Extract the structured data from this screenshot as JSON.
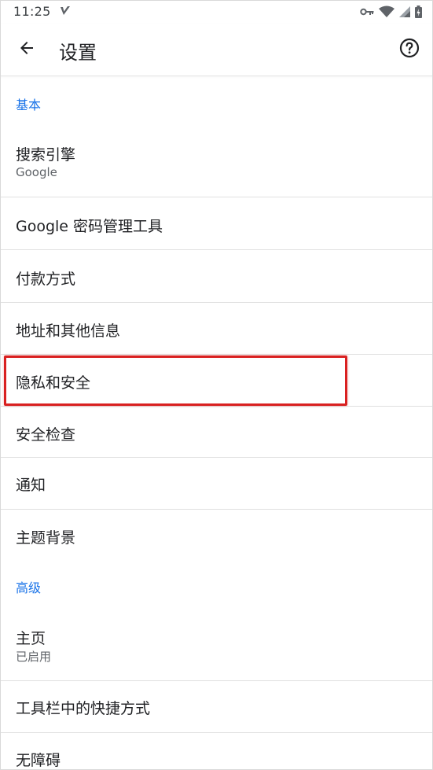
{
  "status_bar": {
    "time": "11:25",
    "icons": [
      "notification-check-icon",
      "vpn-key-icon",
      "wifi-icon",
      "cell-signal-icon",
      "battery-icon"
    ]
  },
  "app_bar": {
    "title": "设置",
    "back_icon": "arrow-back-icon",
    "help_icon": "help-circle-icon"
  },
  "sections": {
    "basic": {
      "header": "基本",
      "items": [
        {
          "label": "搜索引擎",
          "sublabel": "Google"
        },
        {
          "label": "Google 密码管理工具"
        },
        {
          "label": "付款方式"
        },
        {
          "label": "地址和其他信息"
        },
        {
          "label": "隐私和安全"
        },
        {
          "label": "安全检查"
        },
        {
          "label": "通知"
        },
        {
          "label": "主题背景"
        }
      ]
    },
    "advanced": {
      "header": "高级",
      "items": [
        {
          "label": "主页",
          "sublabel": "已启用"
        },
        {
          "label": "工具栏中的快捷方式"
        },
        {
          "label": "无障碍"
        }
      ]
    }
  },
  "colors": {
    "accent": "#1a73e8",
    "highlight": "#d92020",
    "text_primary": "#202124",
    "text_secondary": "#5f6368"
  }
}
